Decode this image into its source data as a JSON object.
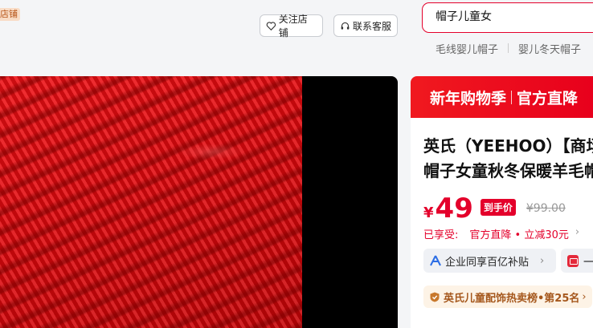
{
  "header": {
    "store_tag": "店铺",
    "follow_label": "关注店铺",
    "service_label": "联系客服",
    "search": {
      "value": "帽子儿童女"
    },
    "hot_words": [
      "毛线婴儿帽子",
      "婴儿冬天帽子"
    ]
  },
  "product": {
    "promo_left": "新年购物季",
    "promo_right": "官方直降",
    "title_line1": "英氏（YEEHOO）【商场",
    "title_line2": "帽子女童秋冬保暖羊毛帽",
    "price_symbol": "¥",
    "price": "49",
    "price_tag": "到手价",
    "original_price": "¥99.00",
    "enjoyed_label": "已享受:",
    "enjoyed_detail": "官方直降 • 立减30元",
    "subsidy_label": "企业同享百亿补贴",
    "red_chip_text": "一",
    "rank_label": "英氏儿童配饰热卖榜•第25名"
  },
  "colors": {
    "accent": "#e4002b",
    "rank": "#a5571c"
  }
}
